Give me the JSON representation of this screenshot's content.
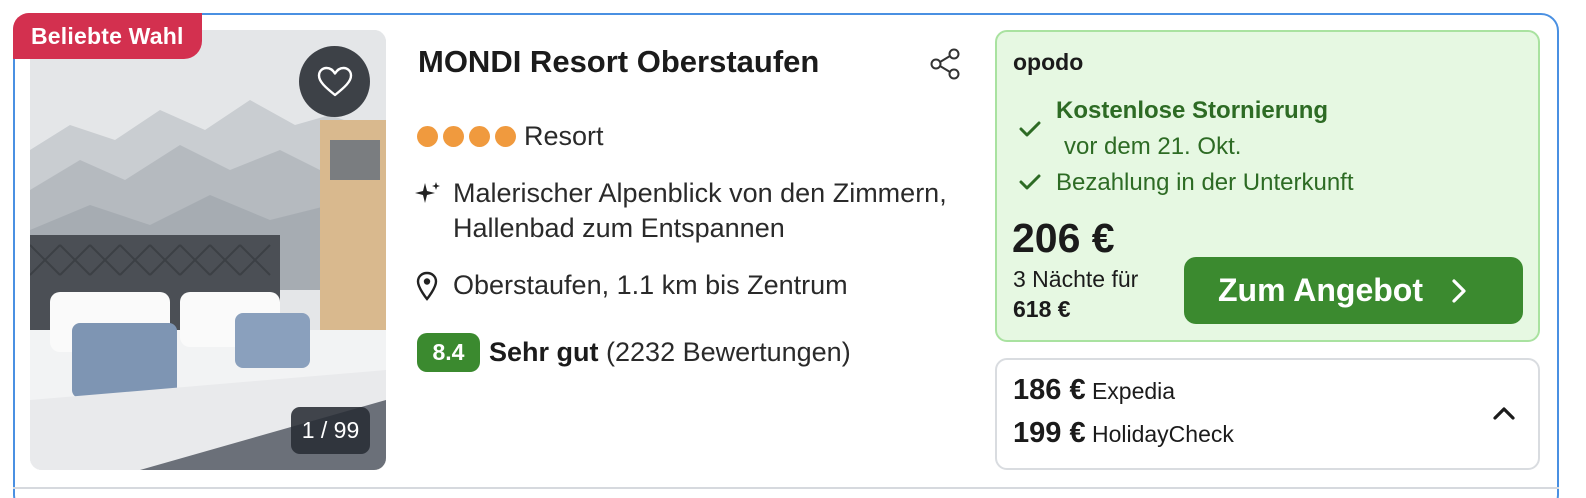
{
  "card": {
    "badge": "Beliebte Wahl",
    "photo_counter": "1 / 99",
    "title": "MONDI Resort Oberstaufen",
    "stars": 4,
    "type": "Resort",
    "highlight": "Malerischer Alpenblick von den Zimmern, Hallenbad zum Entspannen",
    "location": "Oberstaufen, 1.1 km bis Zentrum",
    "rating": {
      "score": "8.4",
      "word": "Sehr gut",
      "count": "(2232 Bewertungen)"
    }
  },
  "offer": {
    "provider": "opodo",
    "free_cancellation": "Kostenlose Stornierung",
    "cancellation_deadline": "vor dem 21. Okt.",
    "payment": "Bezahlung in der Unterkunft",
    "price": "206 €",
    "nights_label": "3 Nächte für",
    "total": "618 €",
    "cta_label": "Zum Angebot"
  },
  "alternatives": [
    {
      "price": "186 €",
      "provider": "Expedia"
    },
    {
      "price": "199 €",
      "provider": "HolidayCheck"
    }
  ],
  "icons": {
    "favorite": "heart-icon",
    "share": "share-icon",
    "highlight": "sparkle-icon",
    "location": "map-pin-icon",
    "check": "check-icon",
    "cta_arrow": "chevron-right-icon",
    "expand": "chevron-up-icon"
  },
  "colors": {
    "badge": "#d3304f",
    "accent_green": "#3b8a2f",
    "offer_bg": "#e6f8e2",
    "star": "#f09a3e",
    "card_border": "#4a90e2"
  }
}
